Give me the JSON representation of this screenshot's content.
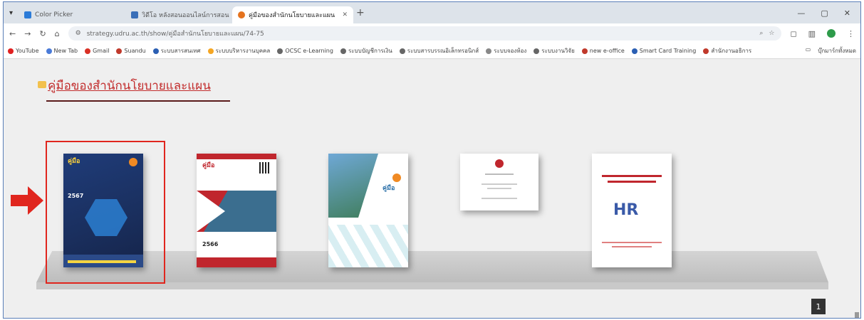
{
  "browser": {
    "tabs": [
      {
        "label": "Color Picker",
        "active": false
      },
      {
        "label": "วิดีโอ หลังสอนออนไลน์การสอน",
        "active": false
      },
      {
        "label": "คู่มือของสำนักนโยบายและแผน",
        "active": true
      }
    ],
    "new_tab": "+",
    "url": "strategy.udru.ac.th/show/คู่มือสำนักนโยบายและแผน/74-75",
    "bookmarks": [
      {
        "label": "YouTube",
        "color": "#e02020"
      },
      {
        "label": "New Tab",
        "color": "#4a7bd8"
      },
      {
        "label": "Gmail",
        "color": "#d93025"
      },
      {
        "label": "Suandu",
        "color": "#c0392b"
      },
      {
        "label": "ระบบสารสนเทศ",
        "color": "#2b5fb3"
      },
      {
        "label": "ระบบบริหารงานบุคคล",
        "color": "#f5a623"
      },
      {
        "label": "OCSC e-Learning",
        "color": "#666666"
      },
      {
        "label": "ระบบบัญชีการเงิน",
        "color": "#666666"
      },
      {
        "label": "ระบบสารบรรณอิเล็กทรอนิกส์",
        "color": "#666666"
      },
      {
        "label": "ระบบจองห้อง",
        "color": "#888888"
      },
      {
        "label": "ระบบงานวิจัย",
        "color": "#666666"
      },
      {
        "label": "new e-office",
        "color": "#c0392b"
      },
      {
        "label": "Smart Card Training",
        "color": "#2b5fb3"
      },
      {
        "label": "สำนักงานอธิการ",
        "color": "#c0392b"
      }
    ],
    "bookmarks_all": "บุ๊กมาร์กทั้งหมด"
  },
  "page": {
    "heading": "คู่มือของสำนักนโยบายและแผน",
    "page_number": "1",
    "books": [
      {
        "title": "คู่มือ",
        "year": "2567",
        "selected": true
      },
      {
        "title": "คู่มือ",
        "year": "2566",
        "selected": false
      },
      {
        "title": "คู่มือ",
        "year": "",
        "selected": false
      },
      {
        "title": "",
        "year": "",
        "selected": false
      },
      {
        "title": "HR",
        "year": "",
        "selected": false
      }
    ]
  },
  "colors": {
    "heading": "#c22c2c",
    "highlight": "#e0261e",
    "shelf": "#c9c9c9"
  }
}
